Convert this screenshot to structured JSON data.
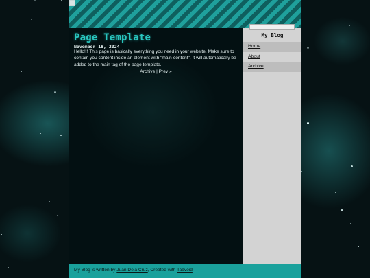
{
  "page": {
    "title": "Page Template",
    "date": "November 18, 2024",
    "body": "Hello!!! This page is basically everything you need in your website. Make sure to contain you content inside an element with \"main-content\". It will automatically be added to the main tag of the page template.",
    "pager": {
      "archive": "Archive",
      "sep": " | ",
      "prev": "Prev »"
    }
  },
  "sidebar": {
    "title": "My Blog",
    "items": [
      {
        "label": "Home"
      },
      {
        "label": "About"
      },
      {
        "label": "Archive"
      }
    ]
  },
  "footer": {
    "prefix": "My Blog is written by ",
    "author": "Juan Dela Cruz",
    "middle": ", Created with ",
    "tool": "Tabvoid"
  },
  "colors": {
    "accent": "#1aa19c",
    "title": "#29c6bf",
    "sidebar_bg": "#d3d3d3",
    "nav_alt": "#bdbdbd"
  },
  "icons": {
    "header_image": "broken-image-icon",
    "sidebar_image": "broken-image-icon"
  }
}
